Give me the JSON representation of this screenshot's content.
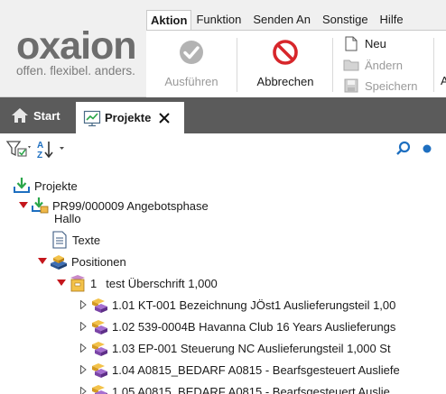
{
  "brand": {
    "wordmark": "oxaion",
    "tagline": "offen. flexibel. anders."
  },
  "menu": {
    "tabs": [
      {
        "label": "Aktion",
        "active": true
      },
      {
        "label": "Funktion",
        "active": false
      },
      {
        "label": "Senden An",
        "active": false
      },
      {
        "label": "Sonstige",
        "active": false
      },
      {
        "label": "Hilfe",
        "active": false
      }
    ]
  },
  "ribbon": {
    "execute": {
      "label": "Ausführen",
      "enabled": false,
      "icon": "check-circle-icon"
    },
    "cancel": {
      "label": "Abbrechen",
      "enabled": true,
      "icon": "no-entry-icon"
    },
    "new": {
      "label": "Neu",
      "enabled": true,
      "icon": "new-document-icon"
    },
    "change": {
      "label": "Ändern",
      "enabled": false,
      "icon": "folder-icon"
    },
    "save": {
      "label": "Speichern",
      "enabled": false,
      "icon": "floppy-icon"
    },
    "cutoff": "A"
  },
  "tabs": {
    "start": {
      "label": "Start",
      "icon": "home-icon"
    },
    "projects": {
      "label": "Projekte",
      "icon": "chart-screen-icon",
      "active": true
    }
  },
  "toolbar": {
    "filter": {
      "icon": "filter-icon"
    },
    "sort": {
      "icon": "sort-az-icon"
    },
    "search": {
      "icon": "search-icon"
    },
    "status": {
      "icon": "dot-icon"
    }
  },
  "colors": {
    "accent_blue": "#1e6fc0",
    "expand_red": "#c4161c",
    "tab_bar": "#5b5b5b",
    "disabled_text": "#9a9a9a"
  },
  "tree": {
    "root": {
      "label": "Projekte"
    },
    "project": {
      "label_line1": "PR99/000009 Angebotsphase",
      "label_line2": "Hallo",
      "expanded": true
    },
    "texts": {
      "label": "Texte"
    },
    "positions": {
      "label": "Positionen",
      "expanded": true
    },
    "heading": {
      "number": "1",
      "label": "test Überschrift 1,000",
      "expanded": true
    },
    "items": [
      {
        "label": "1.01 KT-001 Bezeichnung JÖst1 Auslieferungsteil 1,00"
      },
      {
        "label": "1.02 539-0004B Havanna Club 16 Years Auslieferungs"
      },
      {
        "label": "1.03 EP-001 Steuerung NC Auslieferungsteil 1,000 St"
      },
      {
        "label": "1.04 A0815_BEDARF A0815 - Bearfsgesteuert Ausliefe"
      },
      {
        "label": "1.05 A0815_BEDARF A0815 - Bearfsgesteuert Auslie"
      }
    ]
  }
}
